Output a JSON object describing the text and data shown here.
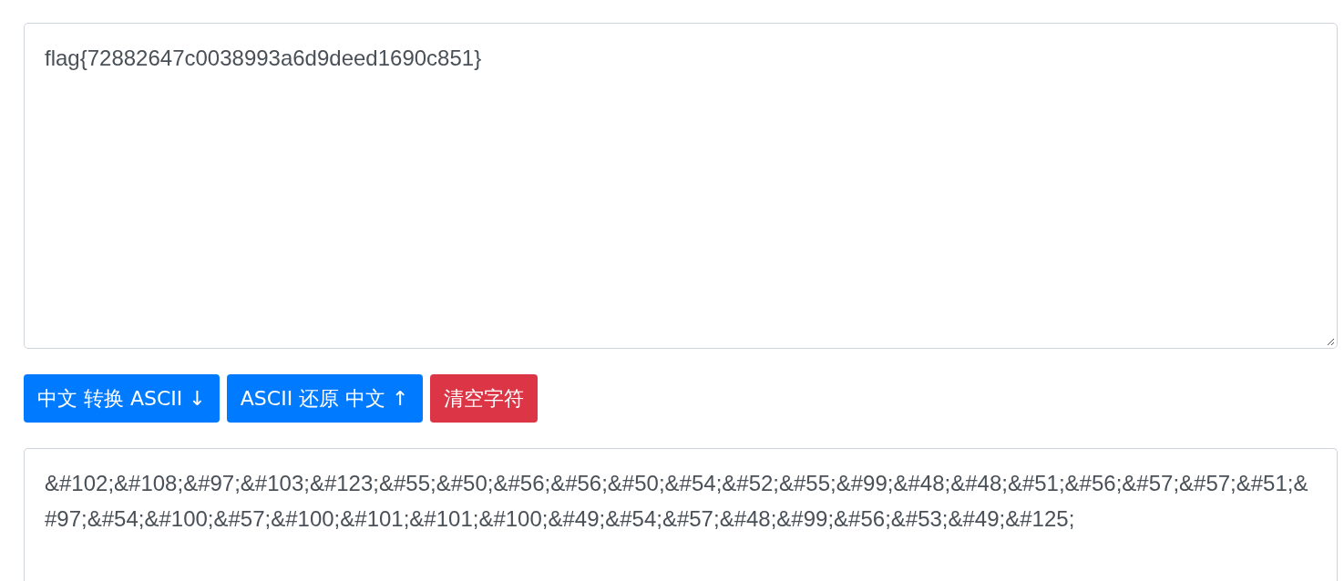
{
  "input": {
    "value": "flag{72882647c0038993a6d9deed1690c851}"
  },
  "buttons": [
    {
      "label": "中文 转换 ASCII ↓",
      "kind": "primary"
    },
    {
      "label": "ASCII 还原 中文 ↑",
      "kind": "primary"
    },
    {
      "label": "清空字符",
      "kind": "danger"
    }
  ],
  "output": {
    "value": "&#102;&#108;&#97;&#103;&#123;&#55;&#50;&#56;&#56;&#50;&#54;&#52;&#55;&#99;&#48;&#48;&#51;&#56;&#57;&#57;&#51;&#97;&#54;&#100;&#57;&#100;&#101;&#101;&#100;&#49;&#54;&#57;&#48;&#99;&#56;&#53;&#49;&#125;"
  }
}
